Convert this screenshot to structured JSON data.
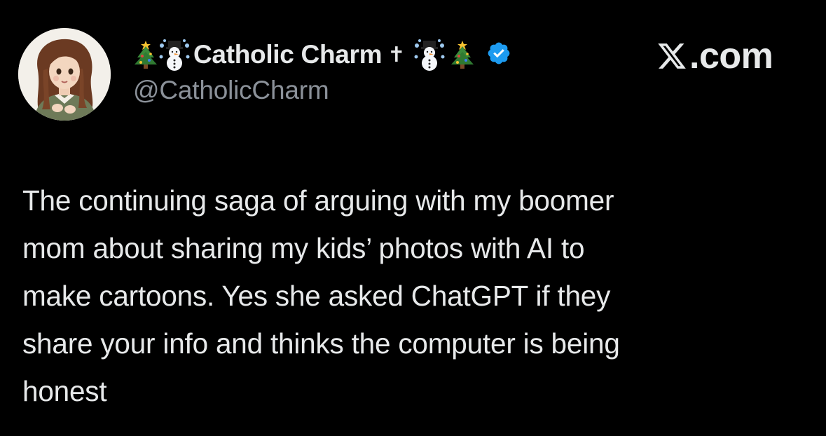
{
  "author": {
    "display_name": "Catholic Charm",
    "name_symbol": "✝",
    "handle": "@CatholicCharm",
    "verified": true,
    "verified_color": "#1d9bf0",
    "avatar_icon": "illustrated-woman-avatar",
    "decorations": [
      "christmas-tree-icon",
      "snowman-icon",
      "snowman-icon",
      "christmas-tree-icon"
    ]
  },
  "source": {
    "label": ".com",
    "logo": "x-logo-icon"
  },
  "tweet": {
    "text": "The continuing saga of arguing with my boomer\nmom about sharing my kids’ photos with AI to\nmake cartoons.  Yes she asked ChatGPT if they\nshare your info and thinks the computer is being\nhonest"
  },
  "colors": {
    "background": "#000000",
    "text": "#e7e9ea",
    "secondary_text": "#8b9199"
  }
}
